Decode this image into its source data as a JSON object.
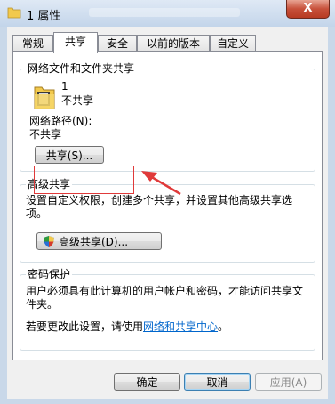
{
  "window": {
    "title": "1 属性",
    "close_label": "X"
  },
  "tabs": [
    {
      "label": "常规"
    },
    {
      "label": "共享"
    },
    {
      "label": "安全"
    },
    {
      "label": "以前的版本"
    },
    {
      "label": "自定义"
    }
  ],
  "network_sharing": {
    "group_title": "网络文件和文件夹共享",
    "folder_name": "1",
    "folder_status": "不共享",
    "path_label": "网络路径(N):",
    "path_value": "不共享",
    "share_button": "共享(S)..."
  },
  "advanced_sharing": {
    "group_title": "高级共享",
    "description": "设置自定义权限，创建多个共享，并设置其他高级共享选项。",
    "button": "高级共享(D)..."
  },
  "password_protection": {
    "group_title": "密码保护",
    "description": "用户必须具有此计算机的用户帐户和密码，才能访问共享文件夹。",
    "change_text": "若要更改此设置，请使用",
    "link_text": "网络和共享中心",
    "suffix": "。"
  },
  "footer": {
    "ok": "确定",
    "cancel": "取消",
    "apply": "应用(A)"
  },
  "colors": {
    "annotation": "#e03a3a",
    "link": "#0066cc"
  }
}
